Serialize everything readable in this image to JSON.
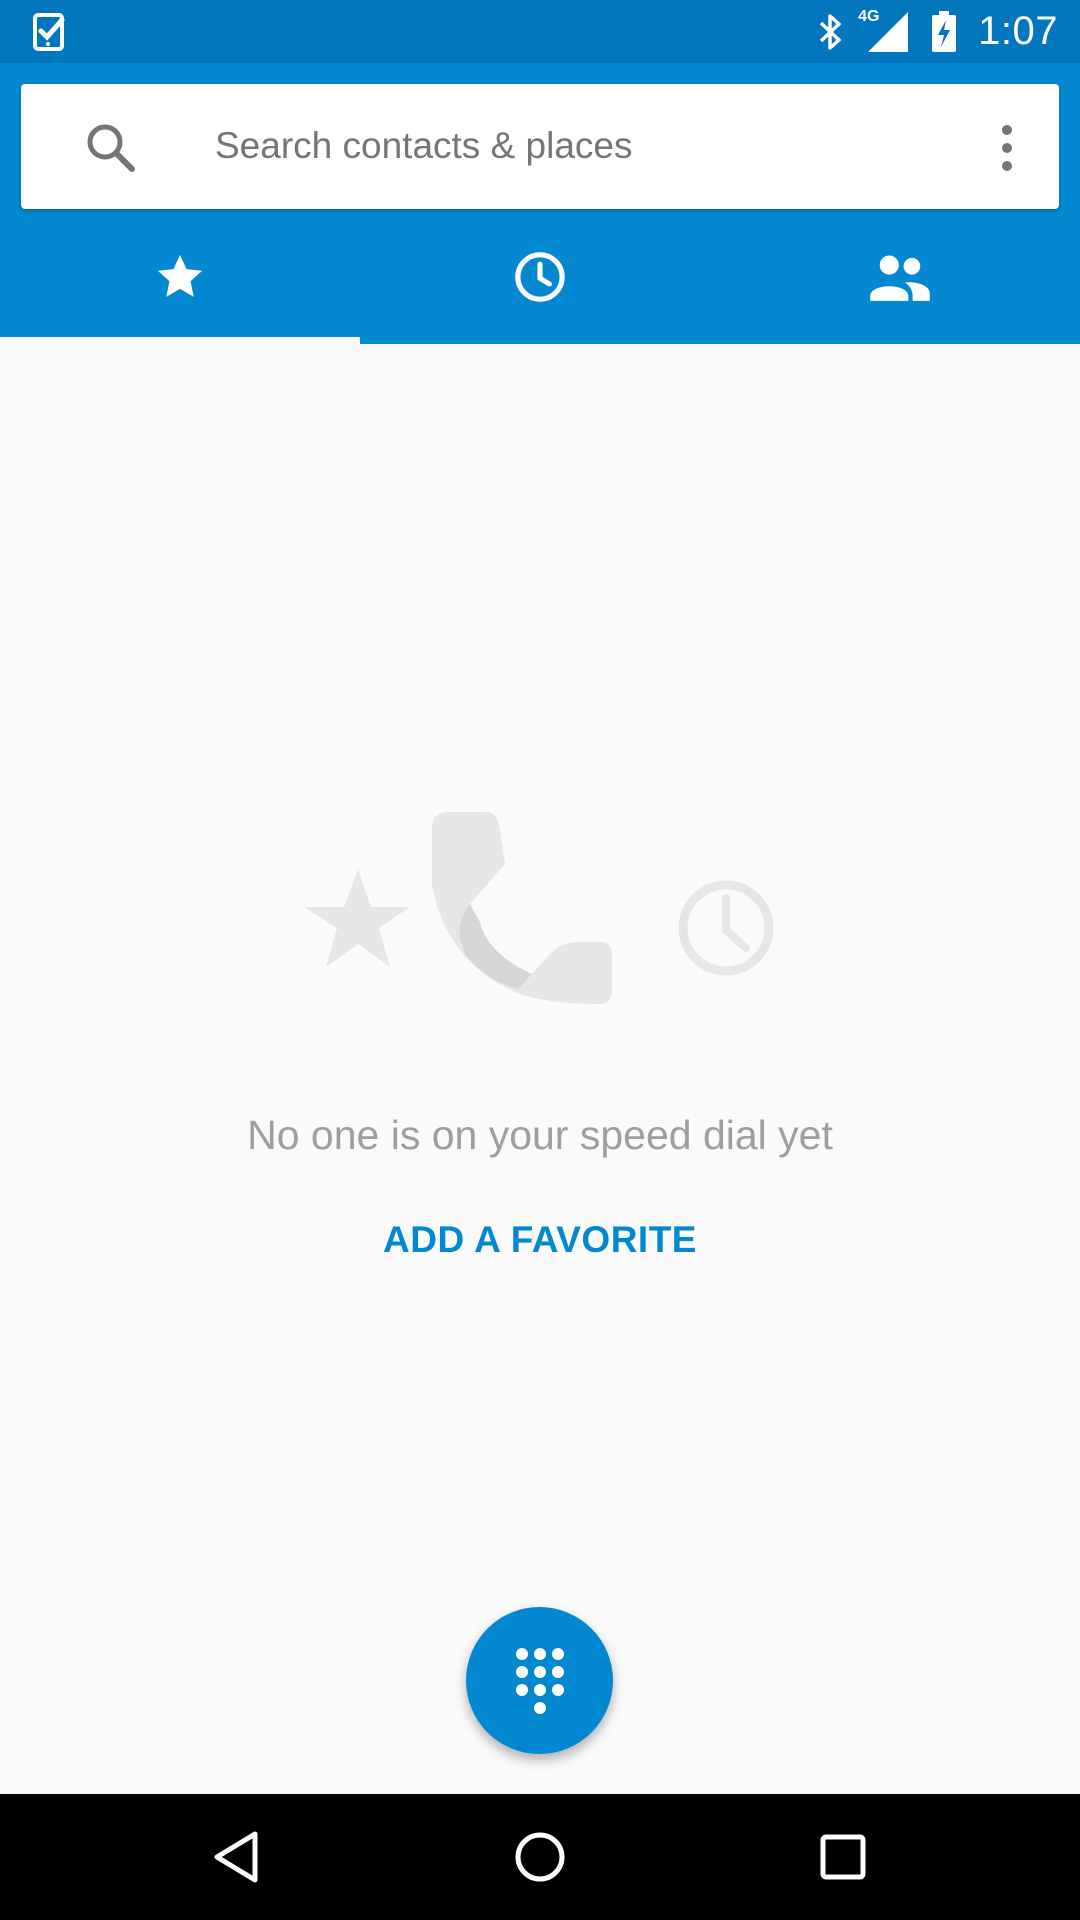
{
  "status_bar": {
    "time": "1:07",
    "network_label": "4G",
    "icons": [
      "task-check-icon",
      "bluetooth-icon",
      "signal-icon",
      "battery-charging-icon"
    ]
  },
  "search": {
    "placeholder": "Search contacts & places",
    "value": ""
  },
  "tabs": [
    {
      "icon": "star-icon",
      "selected": true
    },
    {
      "icon": "clock-icon",
      "selected": false
    },
    {
      "icon": "contacts-icon",
      "selected": false
    }
  ],
  "empty_state": {
    "message": "No one is on your speed dial yet",
    "action_label": "ADD A FAVORITE"
  },
  "fab": {
    "icon": "dialpad-icon"
  },
  "nav_bar": {
    "icons": [
      "back-icon",
      "home-icon",
      "recents-icon"
    ]
  },
  "colors": {
    "status_bar": "#0277bd",
    "app_bar": "#0288d1",
    "accent": "#0288d1",
    "background": "#fafafa"
  }
}
